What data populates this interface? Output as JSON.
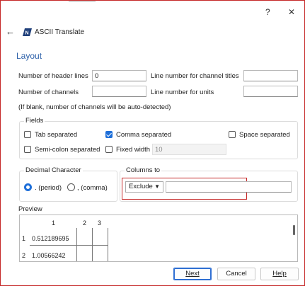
{
  "titlebar": {
    "help": "?",
    "close": "✕"
  },
  "header": {
    "back": "←",
    "app_title": "ASCII Translate"
  },
  "layout": {
    "title": "Layout",
    "header_lines_label": "Number of header lines",
    "header_lines_value": "0",
    "channel_titles_label": "Line number for channel titles",
    "channel_titles_value": "",
    "channels_label": "Number of channels",
    "channels_value": "",
    "units_label": "Line number for units",
    "units_value": "",
    "note": "(If blank, number of channels will be auto-detected)"
  },
  "fields": {
    "title": "Fields",
    "tab": {
      "label": "Tab separated",
      "checked": false
    },
    "comma": {
      "label": "Comma separated",
      "checked": true
    },
    "space": {
      "label": "Space separated",
      "checked": false
    },
    "semicolon": {
      "label": "Semi-colon separated",
      "checked": false
    },
    "fixed": {
      "label": "Fixed width",
      "checked": false,
      "value": "10"
    }
  },
  "decimal": {
    "title": "Decimal Character",
    "period": {
      "label": ". (period)",
      "checked": true
    },
    "comma": {
      "label": ", (comma)",
      "checked": false
    }
  },
  "columns": {
    "title": "Columns to",
    "mode": "Exclude",
    "value": ""
  },
  "preview": {
    "title": "Preview",
    "headers": [
      "1",
      "2",
      "3"
    ],
    "rows": [
      {
        "num": "1",
        "cells": [
          "0.512189695",
          "",
          ""
        ]
      },
      {
        "num": "2",
        "cells": [
          "1.00566242",
          "",
          ""
        ]
      }
    ]
  },
  "footer": {
    "next": "Next",
    "cancel": "Cancel",
    "help": "Help"
  },
  "colors": {
    "accent": "#1e6fd9",
    "highlight": "#c62828",
    "section_title": "#2b5fa8"
  }
}
